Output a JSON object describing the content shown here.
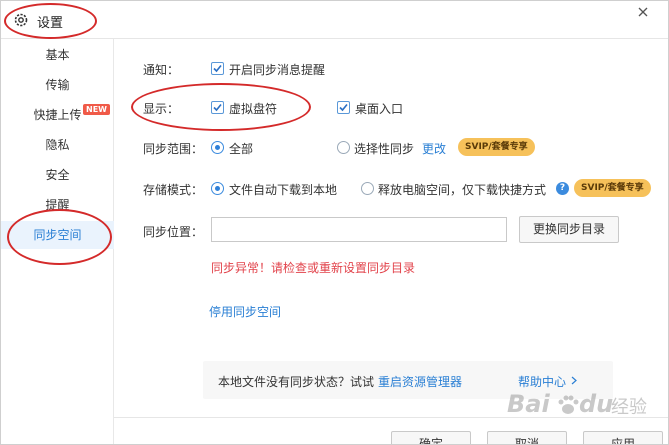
{
  "window": {
    "title": "设置"
  },
  "sidebar": {
    "items": [
      {
        "label": "基本",
        "active": false
      },
      {
        "label": "传输",
        "active": false
      },
      {
        "label": "快捷上传",
        "badge": "NEW",
        "active": false
      },
      {
        "label": "隐私",
        "active": false
      },
      {
        "label": "安全",
        "active": false
      },
      {
        "label": "提醒",
        "active": false
      },
      {
        "label": "同步空间",
        "active": true
      }
    ]
  },
  "notify": {
    "label": "通知：",
    "option": "开启同步消息提醒",
    "checked": true
  },
  "display": {
    "label": "显示：",
    "virtual_drive": "虚拟盘符",
    "virtual_drive_checked": true,
    "desktop_entry": "桌面入口",
    "desktop_entry_checked": true
  },
  "sync_scope": {
    "label": "同步范围：",
    "all": "全部",
    "selected": "all",
    "selective": "选择性同步",
    "change_link": "更改",
    "svip_badge": "SVIP/套餐专享"
  },
  "storage_mode": {
    "label": "存储模式：",
    "auto_download": "文件自动下载到本地",
    "free_space": "释放电脑空间，仅下载快捷方式",
    "selected": "auto_download",
    "help_icon": "?",
    "svip_badge": "SVIP/套餐专享"
  },
  "sync_location": {
    "label": "同步位置：",
    "value": "",
    "change_button": "更换同步目录",
    "error": "同步异常！请检查或重新设置同步目录"
  },
  "disable_link": "停用同步空间",
  "info_bar": {
    "text": "本地文件没有同步状态？试试",
    "restart_link": "重启资源管理器",
    "help_link": "帮助中心"
  },
  "footer": {
    "ok": "确定",
    "cancel": "取消",
    "apply": "应用"
  },
  "watermark": {
    "brand": "Bai",
    "brand2": "du",
    "suffix": "经验"
  },
  "colors": {
    "accent": "#2a7fd4",
    "error": "#e2434b",
    "annotation": "#d42a2a",
    "svip": "#f6c15a"
  }
}
